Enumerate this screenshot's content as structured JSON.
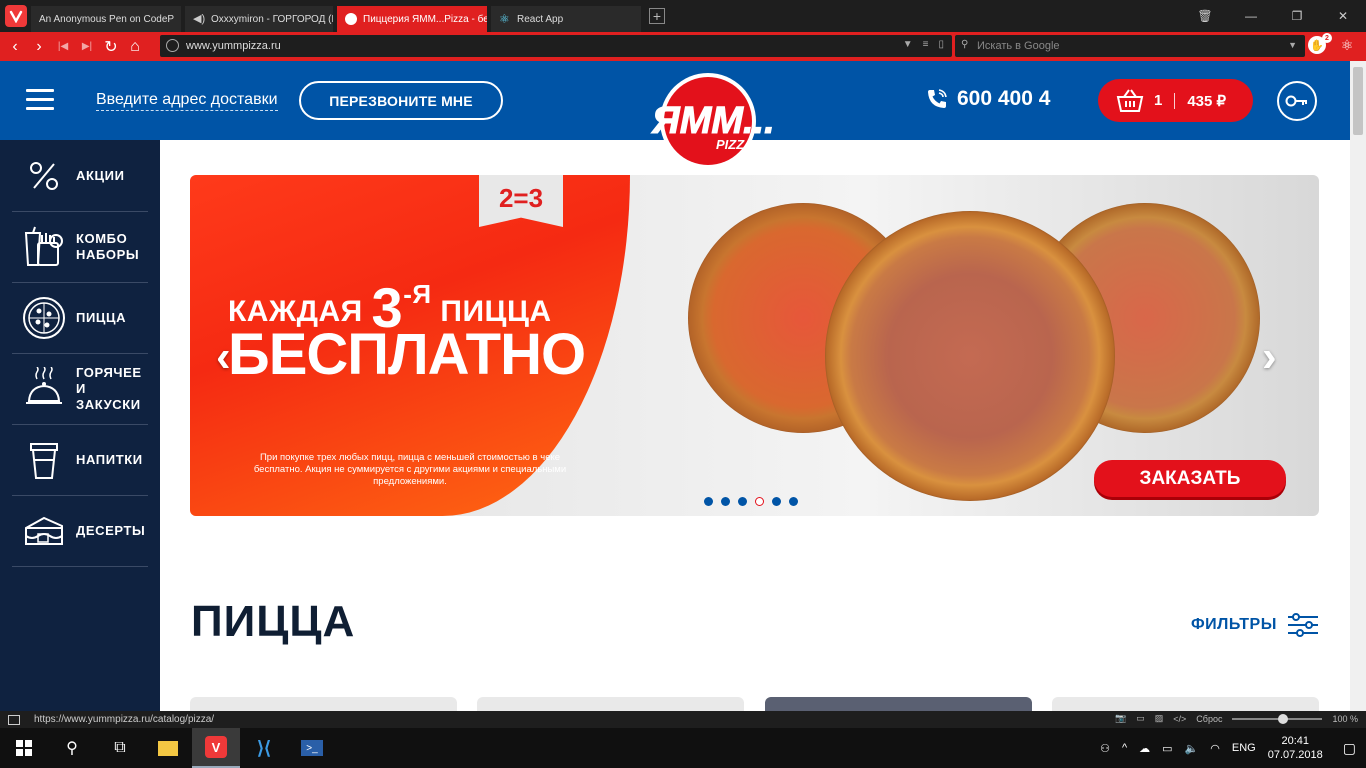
{
  "browser": {
    "tabs": [
      {
        "title": "An Anonymous Pen on CodeP",
        "active": false
      },
      {
        "title": "Oxxxymiron - ГОРГОРОД (Н",
        "active": false
      },
      {
        "title": "Пиццерия ЯММ...Pizza - бес",
        "active": true
      },
      {
        "title": "React App",
        "active": false
      }
    ],
    "url": "www.yummpizza.ru",
    "search_placeholder": "Искать в Google",
    "extension_badge": "2",
    "status_url": "https://www.yummpizza.ru/catalog/pizza/",
    "reset_label": "Сброс",
    "zoom": "100 %"
  },
  "header": {
    "address_link": "Введите адрес доставки",
    "callback_button": "ПЕРЕЗВОНИТЕ МНЕ",
    "logo_text": "ЯММ...",
    "logo_sub": "PIZZA",
    "phone": "600 400 4",
    "cart_count": "1",
    "cart_total": "435 ₽"
  },
  "sidebar": {
    "items": [
      {
        "label": "АКЦИИ",
        "icon": "percent-icon"
      },
      {
        "label": "КОМБО\nНАБОРЫ",
        "icon": "combo-icon"
      },
      {
        "label": "ПИЦЦА",
        "icon": "pizza-icon"
      },
      {
        "label": "ГОРЯЧЕЕ\nИ\nЗАКУСКИ",
        "icon": "cloche-icon"
      },
      {
        "label": "НАПИТКИ",
        "icon": "cup-icon"
      },
      {
        "label": "ДЕСЕРТЫ",
        "icon": "cake-icon"
      }
    ]
  },
  "banner": {
    "ribbon": "2=3",
    "line1_a": "КАЖДАЯ",
    "line1_num": "3",
    "line1_sup": "-Я",
    "line1_b": "ПИЦЦА",
    "line2": "БЕСПЛАТНО",
    "promo_text": "При покупке трех любых пицц, пицца с меньшей стоимостью в чеке бесплатно. Акция не суммируется с другими акциями и специальными предложениями.",
    "order_button": "ЗАКАЗАТЬ",
    "slides_count": 6,
    "active_slide": 4
  },
  "section": {
    "title": "ПИЦЦА",
    "filters_label": "ФИЛЬТРЫ"
  },
  "taskbar": {
    "language": "ENG",
    "time": "20:41",
    "date": "07.07.2018"
  },
  "colors": {
    "brand_blue": "#0054a6",
    "brand_red": "#e3111b",
    "sidebar_bg": "#0f2240"
  }
}
